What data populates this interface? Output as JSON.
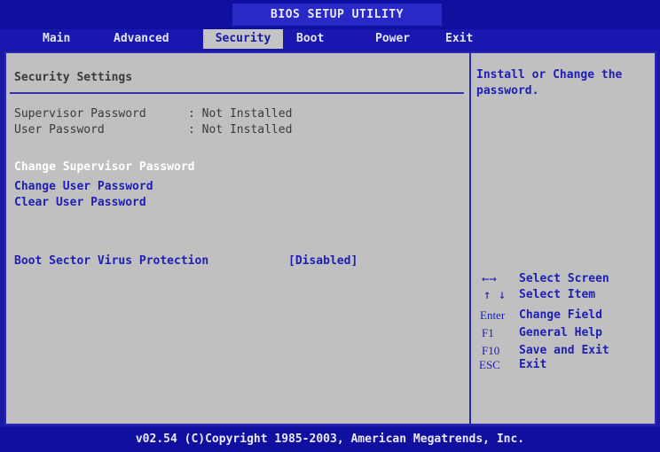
{
  "window": {
    "title": "BIOS SETUP UTILITY"
  },
  "menu": {
    "tabs": [
      {
        "label": "Main"
      },
      {
        "label": "Advanced"
      },
      {
        "label": "Security",
        "active": true
      },
      {
        "label": "Boot"
      },
      {
        "label": "Power"
      },
      {
        "label": "Exit"
      }
    ]
  },
  "main": {
    "section_title": "Security Settings",
    "status": [
      {
        "label": "Supervisor Password",
        "value": ": Not Installed"
      },
      {
        "label": "User Password",
        "value": ": Not Installed"
      }
    ],
    "actions": [
      {
        "label": "Change Supervisor Password",
        "selected": true
      },
      {
        "label": "Change User Password"
      },
      {
        "label": "Clear User Password"
      }
    ],
    "options": [
      {
        "label": "Boot Sector Virus Protection",
        "value": "[Disabled]"
      }
    ]
  },
  "help": {
    "description": "Install or Change the\npassword.",
    "keys": [
      {
        "key": "←→",
        "action": "Select Screen"
      },
      {
        "key": "↑ ↓",
        "action": "Select Item"
      },
      {
        "key": "Enter",
        "action": "Change Field"
      },
      {
        "key": "F1",
        "action": "General Help"
      },
      {
        "key": "F10",
        "action": "Save and Exit"
      },
      {
        "key": "ESC",
        "action": "Exit"
      }
    ]
  },
  "footer": {
    "text": "v02.54 (C)Copyright 1985-2003, American Megatrends, Inc."
  },
  "colors": {
    "background_blue": "#1a1aa6",
    "panel_gray": "#c0c0c0",
    "highlight_blue": "#1e1eb4",
    "selected_text": "#ffffff"
  }
}
